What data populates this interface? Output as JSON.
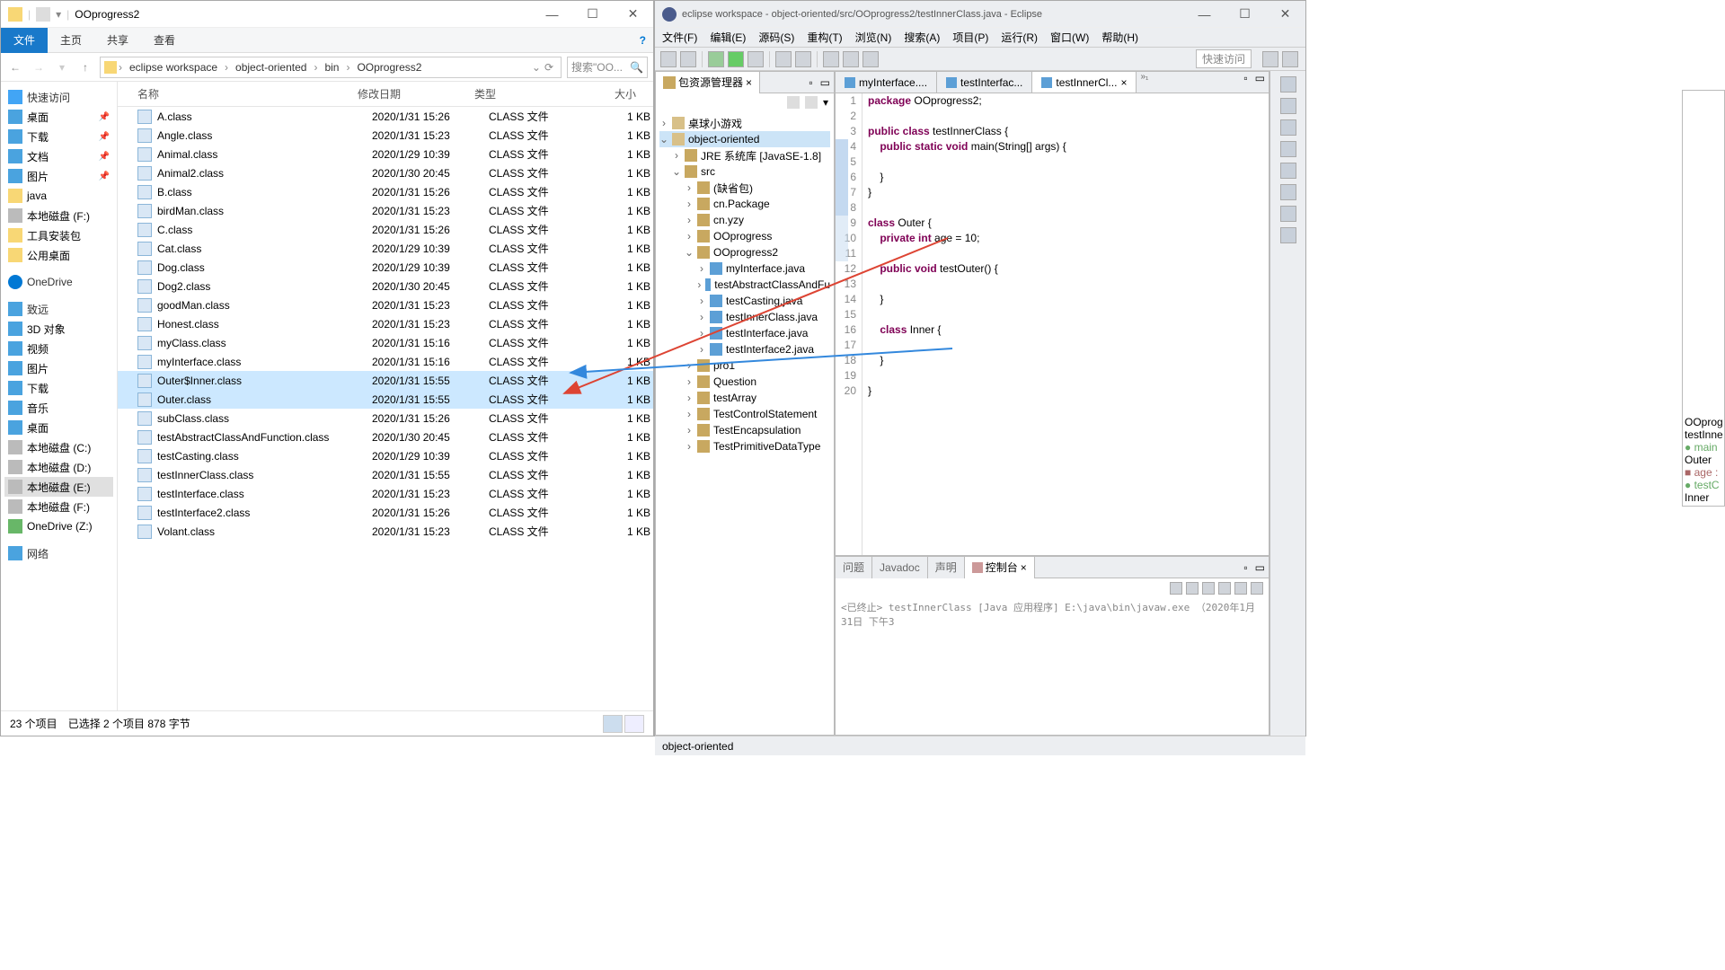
{
  "explorer": {
    "title": "OOprogress2",
    "ribbon": {
      "file": "文件",
      "home": "主页",
      "share": "共享",
      "view": "查看"
    },
    "crumbs": [
      "eclipse workspace",
      "object-oriented",
      "bin",
      "OOprogress2"
    ],
    "search_placeholder": "搜索\"OO...",
    "cols": {
      "name": "名称",
      "date": "修改日期",
      "type": "类型",
      "size": "大小"
    },
    "sidebar": {
      "quick": "快速访问",
      "desktop": "桌面",
      "downloads": "下载",
      "docs": "文档",
      "pics": "图片",
      "java": "java",
      "fdisk": "本地磁盘 (F:)",
      "tools": "工具安装包",
      "pubdesk": "公用桌面",
      "onedrive": "OneDrive",
      "zhiyuan": "致远",
      "threed": "3D 对象",
      "video": "视频",
      "pics2": "图片",
      "downloads2": "下载",
      "music": "音乐",
      "desktop2": "桌面",
      "cdisk": "本地磁盘 (C:)",
      "ddisk": "本地磁盘 (D:)",
      "edisk": "本地磁盘 (E:)",
      "fdisk2": "本地磁盘 (F:)",
      "onedrivez": "OneDrive (Z:)",
      "network": "网络"
    },
    "files": [
      {
        "n": "A.class",
        "d": "2020/1/31 15:26",
        "t": "CLASS 文件",
        "s": "1 KB"
      },
      {
        "n": "Angle.class",
        "d": "2020/1/31 15:23",
        "t": "CLASS 文件",
        "s": "1 KB"
      },
      {
        "n": "Animal.class",
        "d": "2020/1/29 10:39",
        "t": "CLASS 文件",
        "s": "1 KB"
      },
      {
        "n": "Animal2.class",
        "d": "2020/1/30 20:45",
        "t": "CLASS 文件",
        "s": "1 KB"
      },
      {
        "n": "B.class",
        "d": "2020/1/31 15:26",
        "t": "CLASS 文件",
        "s": "1 KB"
      },
      {
        "n": "birdMan.class",
        "d": "2020/1/31 15:23",
        "t": "CLASS 文件",
        "s": "1 KB"
      },
      {
        "n": "C.class",
        "d": "2020/1/31 15:26",
        "t": "CLASS 文件",
        "s": "1 KB"
      },
      {
        "n": "Cat.class",
        "d": "2020/1/29 10:39",
        "t": "CLASS 文件",
        "s": "1 KB"
      },
      {
        "n": "Dog.class",
        "d": "2020/1/29 10:39",
        "t": "CLASS 文件",
        "s": "1 KB"
      },
      {
        "n": "Dog2.class",
        "d": "2020/1/30 20:45",
        "t": "CLASS 文件",
        "s": "1 KB"
      },
      {
        "n": "goodMan.class",
        "d": "2020/1/31 15:23",
        "t": "CLASS 文件",
        "s": "1 KB"
      },
      {
        "n": "Honest.class",
        "d": "2020/1/31 15:23",
        "t": "CLASS 文件",
        "s": "1 KB"
      },
      {
        "n": "myClass.class",
        "d": "2020/1/31 15:16",
        "t": "CLASS 文件",
        "s": "1 KB"
      },
      {
        "n": "myInterface.class",
        "d": "2020/1/31 15:16",
        "t": "CLASS 文件",
        "s": "1 KB"
      },
      {
        "n": "Outer$Inner.class",
        "d": "2020/1/31 15:55",
        "t": "CLASS 文件",
        "s": "1 KB",
        "sel": true
      },
      {
        "n": "Outer.class",
        "d": "2020/1/31 15:55",
        "t": "CLASS 文件",
        "s": "1 KB",
        "sel": true
      },
      {
        "n": "subClass.class",
        "d": "2020/1/31 15:26",
        "t": "CLASS 文件",
        "s": "1 KB"
      },
      {
        "n": "testAbstractClassAndFunction.class",
        "d": "2020/1/30 20:45",
        "t": "CLASS 文件",
        "s": "1 KB"
      },
      {
        "n": "testCasting.class",
        "d": "2020/1/29 10:39",
        "t": "CLASS 文件",
        "s": "1 KB"
      },
      {
        "n": "testInnerClass.class",
        "d": "2020/1/31 15:55",
        "t": "CLASS 文件",
        "s": "1 KB"
      },
      {
        "n": "testInterface.class",
        "d": "2020/1/31 15:23",
        "t": "CLASS 文件",
        "s": "1 KB"
      },
      {
        "n": "testInterface2.class",
        "d": "2020/1/31 15:26",
        "t": "CLASS 文件",
        "s": "1 KB"
      },
      {
        "n": "Volant.class",
        "d": "2020/1/31 15:23",
        "t": "CLASS 文件",
        "s": "1 KB"
      }
    ],
    "status": {
      "count": "23 个项目",
      "sel": "已选择 2 个项目  878 字节"
    }
  },
  "eclipse": {
    "title": "eclipse workspace - object-oriented/src/OOprogress2/testInnerClass.java - Eclipse",
    "menu": [
      "文件(F)",
      "编辑(E)",
      "源码(S)",
      "重构(T)",
      "浏览(N)",
      "搜索(A)",
      "项目(P)",
      "运行(R)",
      "窗口(W)",
      "帮助(H)"
    ],
    "quick": "快速访问",
    "pkg_title": "包资源管理器",
    "tree": {
      "ball": "桌球小游戏",
      "proj": "object-oriented",
      "jre": "JRE 系统库 [JavaSE-1.8]",
      "src": "src",
      "defpkg": "(缺省包)",
      "cnpkg": "cn.Package",
      "cnyzy": "cn.yzy",
      "oop": "OOprogress",
      "oop2": "OOprogress2",
      "myif": "myInterface.java",
      "tabs": "testAbstractClassAndFu",
      "tcast": "testCasting.java",
      "tinner": "testInnerClass.java",
      "tif": "testInterface.java",
      "tif2": "testInterface2.java",
      "pro1": "pro1",
      "question": "Question",
      "tarray": "testArray",
      "tctrl": "TestControlStatement",
      "tenc": "TestEncapsulation",
      "tprim": "TestPrimitiveDataType"
    },
    "tabs": {
      "t1": "myInterface....",
      "t2": "testInterfac...",
      "t3": "testInnerCl..."
    },
    "code_lines": [
      "1",
      "2",
      "3",
      "4",
      "5",
      "6",
      "7",
      "8",
      "9",
      "10",
      "11",
      "12",
      "13",
      "14",
      "15",
      "16",
      "17",
      "18",
      "19",
      "20"
    ],
    "console_tabs": {
      "prob": "问题",
      "javadoc": "Javadoc",
      "decl": "声明",
      "console": "控制台"
    },
    "console_line": "<已终止> testInnerClass [Java 应用程序] E:\\java\\bin\\javaw.exe （2020年1月31日 下午3",
    "status": "object-oriented",
    "outline": {
      "oo": "OOprog",
      "ti": "testInne",
      "main": "main",
      "outer": "Outer",
      "age": "age :",
      "to": "testC",
      "inner": "Inner"
    }
  }
}
